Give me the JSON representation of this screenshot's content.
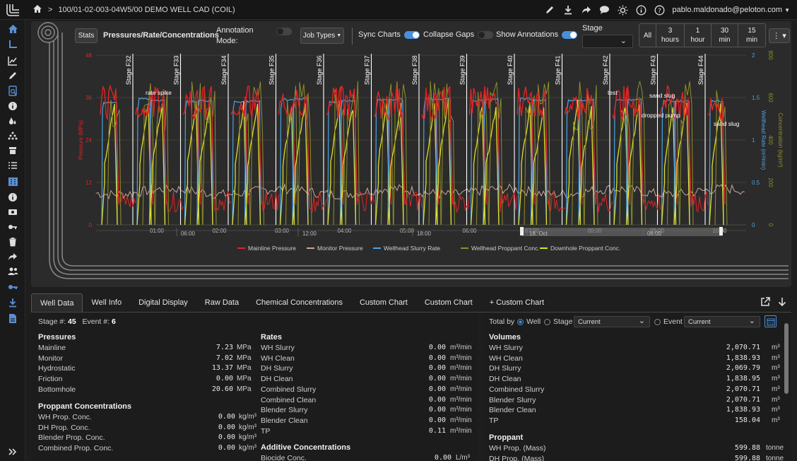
{
  "breadcrumb": {
    "separator": ">",
    "well": "100/01-02-003-04W5/00 DEMO WELL CAD (COIL)"
  },
  "user": {
    "email": "pablo.maldonado@peloton.com"
  },
  "toolbar": {
    "stats": "Stats",
    "title": "Pressures/Rate/Concentrations",
    "annotation_mode": "Annotation Mode:",
    "job_types": "Job Types",
    "sync_charts": "Sync Charts",
    "collapse_gaps": "Collapse Gaps",
    "show_annotations": "Show Annotations",
    "stage_label": "Stage",
    "stage_value": "",
    "time_buttons": [
      {
        "l1": "All",
        "l2": ""
      },
      {
        "l1": "3",
        "l2": "hours"
      },
      {
        "l1": "1",
        "l2": "hour"
      },
      {
        "l1": "30",
        "l2": "min"
      },
      {
        "l1": "15",
        "l2": "min"
      }
    ]
  },
  "chart_data": {
    "type": "line",
    "series": [
      {
        "name": "Mainline Pressure",
        "color": "#e02424"
      },
      {
        "name": "Monitor Pressure",
        "color": "#c8a89a"
      },
      {
        "name": "Wellhead Slurry Rate",
        "color": "#4aa3e6"
      },
      {
        "name": "Wellhead Proppant Conc.",
        "color": "#8f8f2a"
      },
      {
        "name": "Downhole Proppant Conc.",
        "color": "#e0e02a"
      }
    ],
    "left_axis": {
      "label": "Pressure (MPa)",
      "ticks": [
        "0",
        "12",
        "24",
        "36",
        "48"
      ],
      "color": "#e02424"
    },
    "right_axis_rate": {
      "label": "Wellhead Rate (m³/min)",
      "ticks": [
        "0",
        "0.5",
        "1",
        "1.5",
        "2"
      ],
      "color": "#4aa3e6"
    },
    "right_axis_conc": {
      "label": "Concentration (kg/m³)",
      "ticks": [
        "0",
        "200",
        "400",
        "600",
        "800"
      ],
      "color": "#8f8f2a"
    },
    "x_ticks_top": [
      "01:00",
      "02:00",
      "03:00",
      "04:00",
      "05:00",
      "06:00",
      "07:00",
      "08:00",
      "09:00",
      "10:00"
    ],
    "x_ticks_bottom": [
      "06:00",
      "12:00",
      "18:00",
      "18. Oct",
      "06:00"
    ],
    "stages": [
      "Stage F32",
      "Stage F33",
      "Stage F34",
      "Stage F35",
      "Stage F36",
      "Stage F37",
      "Stage F38",
      "Stage F39",
      "Stage F40",
      "Stage F41",
      "Stage F42",
      "Stage F43",
      "Stage F44"
    ],
    "annotations": [
      "rate spike",
      "test",
      "sand slug",
      "dropped pump",
      "sand slug"
    ]
  },
  "tabs": [
    "Well Data",
    "Well Info",
    "Digital Display",
    "Raw Data",
    "Chemical Concentrations",
    "Custom Chart",
    "Custom Chart",
    "+ Custom Chart"
  ],
  "well_data": {
    "stage_label": "Stage #:",
    "stage_value": "45",
    "event_label": "Event #:",
    "event_value": "6",
    "pressures_title": "Pressures",
    "pressures": [
      {
        "label": "Mainline",
        "value": "7.23",
        "unit": "MPa"
      },
      {
        "label": "Monitor",
        "value": "7.02",
        "unit": "MPa"
      },
      {
        "label": "Hydrostatic",
        "value": "13.37",
        "unit": "MPa"
      },
      {
        "label": "Friction",
        "value": "0.00",
        "unit": "MPa"
      },
      {
        "label": "Bottomhole",
        "value": "20.60",
        "unit": "MPa"
      }
    ],
    "proppant_conc_title": "Proppant Concentrations",
    "proppant_conc": [
      {
        "label": "WH Prop. Conc.",
        "value": "0.00",
        "unit": "kg/m³"
      },
      {
        "label": "DH Prop. Conc.",
        "value": "0.00",
        "unit": "kg/m³"
      },
      {
        "label": "Blender Prop. Conc.",
        "value": "0.00",
        "unit": "kg/m³"
      },
      {
        "label": "Combined Prop. Conc.",
        "value": "0.00",
        "unit": "kg/m³"
      }
    ],
    "rates_title": "Rates",
    "rates": [
      {
        "label": "WH Slurry",
        "value": "0.00",
        "unit": "m³/min"
      },
      {
        "label": "WH Clean",
        "value": "0.00",
        "unit": "m³/min"
      },
      {
        "label": "DH Slurry",
        "value": "0.00",
        "unit": "m³/min"
      },
      {
        "label": "DH Clean",
        "value": "0.00",
        "unit": "m³/min"
      },
      {
        "label": "Combined Slurry",
        "value": "0.00",
        "unit": "m³/min"
      },
      {
        "label": "Combined Clean",
        "value": "0.00",
        "unit": "m³/min"
      },
      {
        "label": "Blender Slurry",
        "value": "0.00",
        "unit": "m³/min"
      },
      {
        "label": "Blender Clean",
        "value": "0.00",
        "unit": "m³/min"
      },
      {
        "label": "TP",
        "value": "0.11",
        "unit": "m³/min"
      }
    ],
    "additive_title": "Additive Concentrations",
    "additive": [
      {
        "label": "Biocide Conc.",
        "value": "0.00",
        "unit": "L/m³"
      }
    ]
  },
  "totals": {
    "total_by": "Total by",
    "well": "Well",
    "stage": "Stage",
    "stage_select": "Current",
    "event": "Event",
    "event_select": "Current",
    "volumes_title": "Volumes",
    "volumes": [
      {
        "label": "WH Slurry",
        "value": "2,070.71",
        "unit": "m³"
      },
      {
        "label": "WH Clean",
        "value": "1,838.93",
        "unit": "m³"
      },
      {
        "label": "DH Slurry",
        "value": "2,069.79",
        "unit": "m³"
      },
      {
        "label": "DH Clean",
        "value": "1,838.95",
        "unit": "m³"
      },
      {
        "label": "Combined Slurry",
        "value": "2,070.71",
        "unit": "m³"
      },
      {
        "label": "Blender Slurry",
        "value": "2,070.71",
        "unit": "m³"
      },
      {
        "label": "Blender Clean",
        "value": "1,838.93",
        "unit": "m³"
      },
      {
        "label": "TP",
        "value": "158.04",
        "unit": "m³"
      }
    ],
    "proppant_title": "Proppant",
    "proppant": [
      {
        "label": "WH Prop. (Mass)",
        "value": "599.88",
        "unit": "tonne"
      },
      {
        "label": "DH Prop. (Mass)",
        "value": "599.88",
        "unit": "tonne"
      }
    ]
  }
}
